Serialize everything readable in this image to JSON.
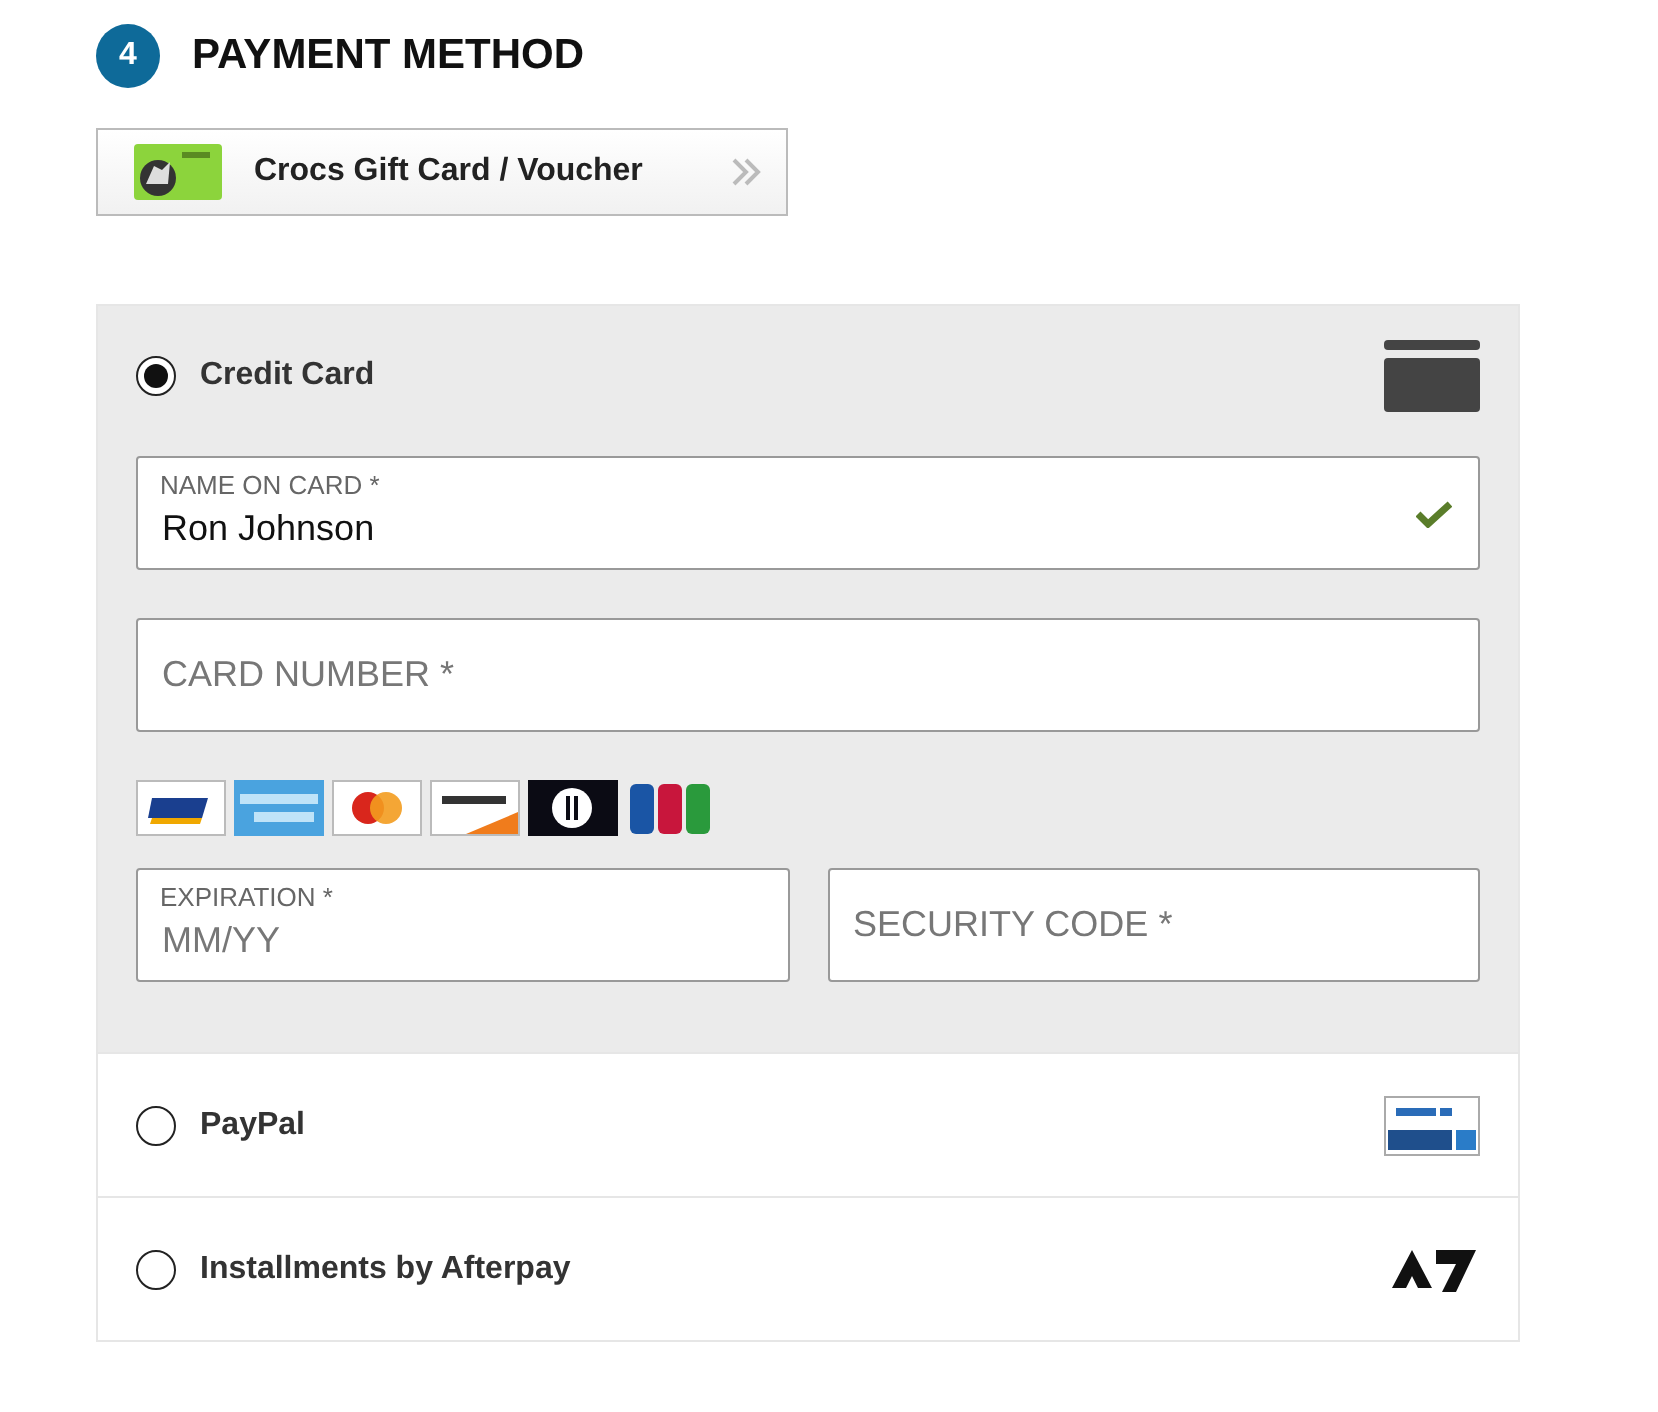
{
  "step": {
    "number": "4",
    "title": "PAYMENT METHOD"
  },
  "gift_card": {
    "label": "Crocs Gift Card / Voucher"
  },
  "methods": [
    {
      "kind": "card",
      "label": "Credit Card",
      "selected": true,
      "rows": [
        {
          "kind": "fields",
          "fields": [
            {
              "label": "NAME ON CARD *",
              "value": "Ron Johnson",
              "valid": true
            }
          ]
        },
        {
          "kind": "fields",
          "fields": [
            {
              "placeholder": "CARD NUMBER *"
            }
          ]
        },
        {
          "kind": "card-logos"
        },
        {
          "kind": "fields",
          "fields": [
            {
              "label": "EXPIRATION *",
              "placeholder": "MM/YY"
            },
            {
              "placeholder": "SECURITY CODE *"
            }
          ]
        }
      ]
    },
    {
      "kind": "paypal",
      "label": "PayPal",
      "selected": false
    },
    {
      "kind": "afterpay",
      "label": "Installments by Afterpay",
      "selected": false
    }
  ]
}
